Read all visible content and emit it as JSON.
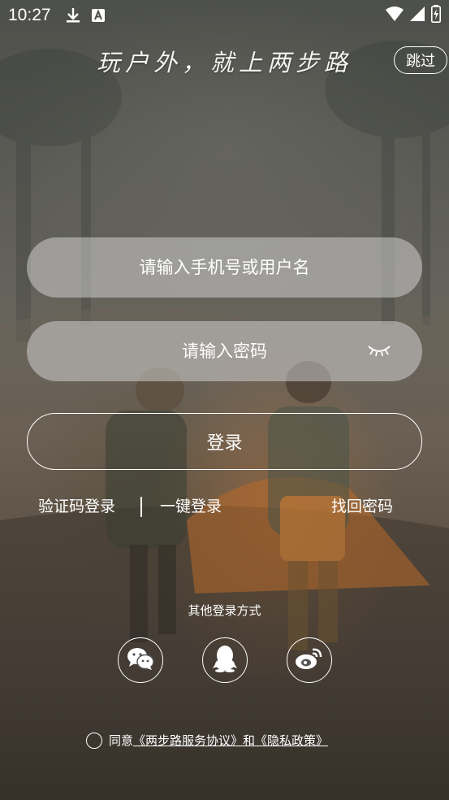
{
  "status_bar": {
    "time": "10:27",
    "icons_left": [
      "download-icon",
      "a-badge-icon"
    ],
    "icons_right": [
      "wifi-icon",
      "signal-icon",
      "battery-charging-icon"
    ]
  },
  "header": {
    "slogan": "玩户外，就上两步路",
    "skip_label": "跳过"
  },
  "form": {
    "username_placeholder": "请输入手机号或用户名",
    "password_placeholder": "请输入密码",
    "login_label": "登录"
  },
  "links": {
    "sms_login": "验证码登录",
    "one_tap_login": "一键登录",
    "forgot_password": "找回密码"
  },
  "other_login": {
    "title": "其他登录方式",
    "providers": [
      "wechat-icon",
      "qq-icon",
      "weibo-icon"
    ]
  },
  "agreement": {
    "prefix": "同意",
    "service": "《两步路服务协议》",
    "and": "和",
    "privacy": "《隐私政策》"
  },
  "colors": {
    "text": "#ffffff",
    "field_bg": "rgba(230,230,230,0.45)"
  }
}
